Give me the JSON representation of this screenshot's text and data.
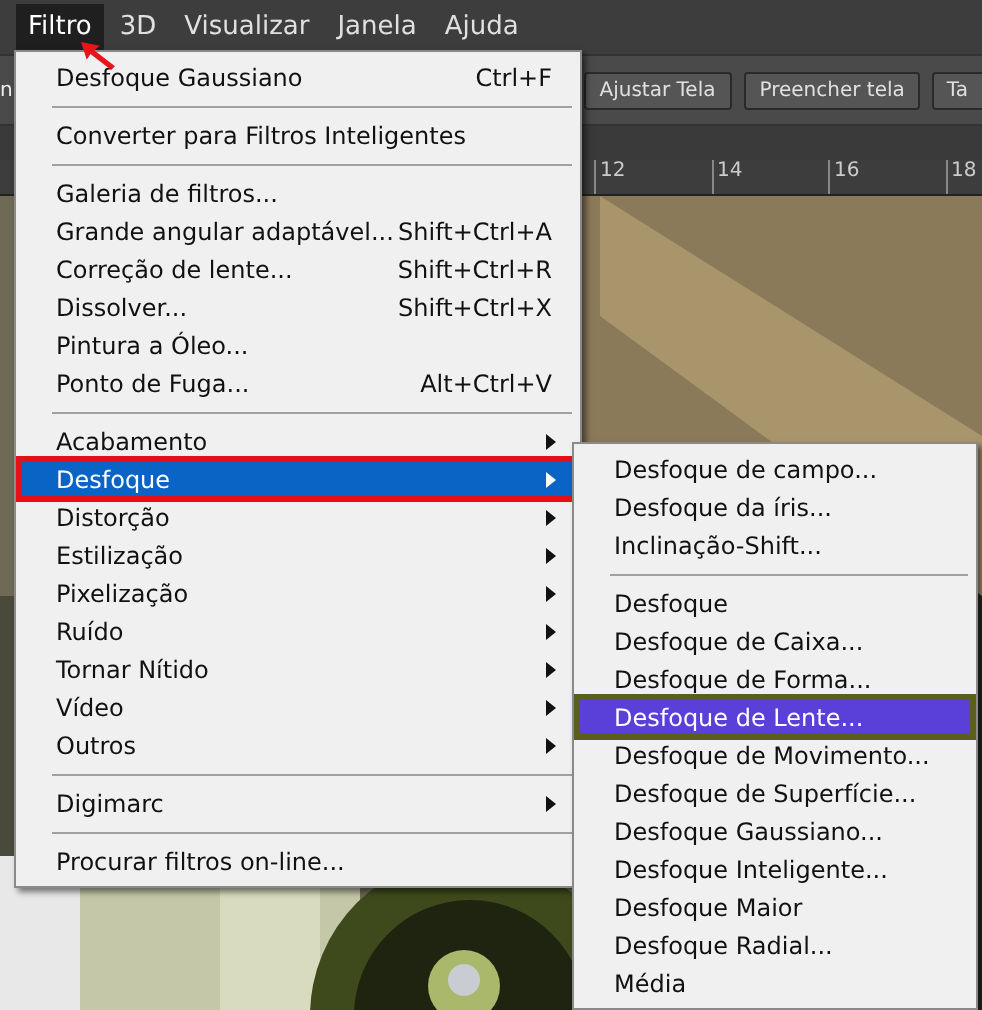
{
  "menubar": [
    {
      "label": "Filtro",
      "selected": true
    },
    {
      "label": "3D",
      "selected": false
    },
    {
      "label": "Visualizar",
      "selected": false
    },
    {
      "label": "Janela",
      "selected": false
    },
    {
      "label": "Ajuda",
      "selected": false
    }
  ],
  "options_bar": {
    "left_text": "n",
    "buttons": [
      "Ajustar Tela",
      "Preencher tela",
      "Ta"
    ]
  },
  "ruler": {
    "ticks": [
      "12",
      "14",
      "16",
      "18"
    ]
  },
  "filter_menu": [
    {
      "kind": "item",
      "label": "Desfoque Gaussiano",
      "shortcut": "Ctrl+F",
      "submenu": false,
      "selected": false
    },
    {
      "kind": "separator"
    },
    {
      "kind": "item",
      "label": "Converter para Filtros Inteligentes",
      "submenu": false,
      "selected": false
    },
    {
      "kind": "separator"
    },
    {
      "kind": "item",
      "label": "Galeria de filtros...",
      "submenu": false,
      "selected": false
    },
    {
      "kind": "item",
      "label": "Grande angular adaptável...",
      "shortcut": "Shift+Ctrl+A",
      "submenu": false,
      "selected": false
    },
    {
      "kind": "item",
      "label": "Correção de lente...",
      "shortcut": "Shift+Ctrl+R",
      "submenu": false,
      "selected": false
    },
    {
      "kind": "item",
      "label": "Dissolver...",
      "shortcut": "Shift+Ctrl+X",
      "submenu": false,
      "selected": false
    },
    {
      "kind": "item",
      "label": "Pintura a Óleo...",
      "submenu": false,
      "selected": false
    },
    {
      "kind": "item",
      "label": "Ponto de Fuga...",
      "shortcut": "Alt+Ctrl+V",
      "submenu": false,
      "selected": false
    },
    {
      "kind": "separator"
    },
    {
      "kind": "item",
      "label": "Acabamento",
      "submenu": true,
      "selected": false
    },
    {
      "kind": "item",
      "label": "Desfoque",
      "submenu": true,
      "selected": true
    },
    {
      "kind": "item",
      "label": "Distorção",
      "submenu": true,
      "selected": false
    },
    {
      "kind": "item",
      "label": "Estilização",
      "submenu": true,
      "selected": false
    },
    {
      "kind": "item",
      "label": "Pixelização",
      "submenu": true,
      "selected": false
    },
    {
      "kind": "item",
      "label": "Ruído",
      "submenu": true,
      "selected": false
    },
    {
      "kind": "item",
      "label": "Tornar Nítido",
      "submenu": true,
      "selected": false
    },
    {
      "kind": "item",
      "label": "Vídeo",
      "submenu": true,
      "selected": false
    },
    {
      "kind": "item",
      "label": "Outros",
      "submenu": true,
      "selected": false
    },
    {
      "kind": "separator"
    },
    {
      "kind": "item",
      "label": "Digimarc",
      "submenu": true,
      "selected": false
    },
    {
      "kind": "separator"
    },
    {
      "kind": "item",
      "label": "Procurar filtros on-line...",
      "submenu": false,
      "selected": false
    }
  ],
  "blur_submenu": [
    {
      "kind": "item",
      "label": "Desfoque de campo...",
      "selected": false
    },
    {
      "kind": "item",
      "label": "Desfoque da íris...",
      "selected": false
    },
    {
      "kind": "item",
      "label": "Inclinação-Shift...",
      "selected": false
    },
    {
      "kind": "separator"
    },
    {
      "kind": "item",
      "label": "Desfoque",
      "selected": false
    },
    {
      "kind": "item",
      "label": "Desfoque de Caixa...",
      "selected": false
    },
    {
      "kind": "item",
      "label": "Desfoque de Forma...",
      "selected": false
    },
    {
      "kind": "item",
      "label": "Desfoque de Lente...",
      "selected": true
    },
    {
      "kind": "item",
      "label": "Desfoque de Movimento...",
      "selected": false
    },
    {
      "kind": "item",
      "label": "Desfoque de Superfície...",
      "selected": false
    },
    {
      "kind": "item",
      "label": "Desfoque Gaussiano...",
      "selected": false
    },
    {
      "kind": "item",
      "label": "Desfoque Inteligente...",
      "selected": false
    },
    {
      "kind": "item",
      "label": "Desfoque Maior",
      "selected": false
    },
    {
      "kind": "item",
      "label": "Desfoque Radial...",
      "selected": false
    },
    {
      "kind": "item",
      "label": "Média",
      "selected": false
    }
  ]
}
